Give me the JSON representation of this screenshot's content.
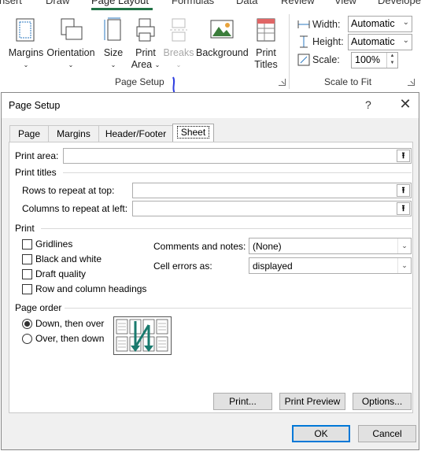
{
  "ribbon": {
    "tabs": [
      "nsert",
      "Draw",
      "Page Layout",
      "Formulas",
      "Data",
      "Review",
      "View",
      "Develope"
    ],
    "buttons": {
      "margins": "Margins",
      "orientation": "Orientation",
      "size": "Size",
      "print_area_1": "Print",
      "print_area_2": "Area",
      "breaks": "Breaks",
      "background": "Background",
      "print_titles_1": "Print",
      "print_titles_2": "Titles"
    },
    "page_setup_group": "Page Setup",
    "scale_to_fit": {
      "group": "Scale to Fit",
      "width_label": "Width:",
      "width_value": "Automatic",
      "height_label": "Height:",
      "height_value": "Automatic",
      "scale_label": "Scale:",
      "scale_value": "100%"
    },
    "accent_color": "#217346"
  },
  "dialog": {
    "title": "Page Setup",
    "help": "?",
    "close": "✕",
    "tabs": [
      "Page",
      "Margins",
      "Header/Footer",
      "Sheet"
    ],
    "selected_tab": "Sheet",
    "print_area_label": "Print area:",
    "print_area_value": "",
    "print_titles_label": "Print titles",
    "rows_label": "Rows to repeat at top:",
    "rows_value": "",
    "cols_label": "Columns to repeat at left:",
    "cols_value": "",
    "print_section": "Print",
    "checkboxes": [
      {
        "label": "Gridlines",
        "checked": false
      },
      {
        "label": "Black and white",
        "checked": false
      },
      {
        "label": "Draft quality",
        "checked": false
      },
      {
        "label": "Row and column headings",
        "checked": false
      }
    ],
    "comments_label": "Comments and notes:",
    "comments_value": "(None)",
    "cell_errors_label": "Cell errors as:",
    "cell_errors_value": "displayed",
    "page_order_label": "Page order",
    "radios": [
      {
        "label": "Down, then over",
        "checked": true
      },
      {
        "label": "Over, then down",
        "checked": false
      }
    ],
    "buttons": {
      "print": "Print...",
      "print_preview": "Print Preview",
      "options": "Options...",
      "ok": "OK",
      "cancel": "Cancel"
    },
    "focus_color": "#0078d7"
  }
}
